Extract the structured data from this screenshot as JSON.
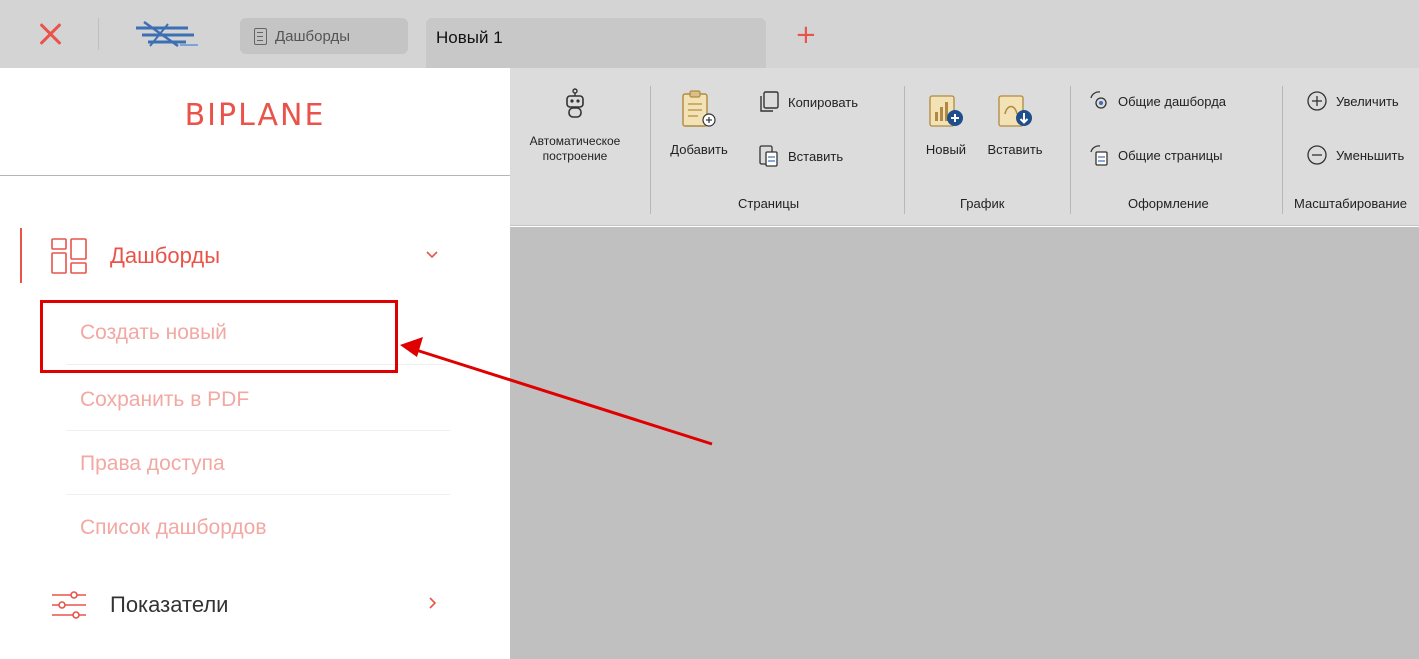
{
  "window": {
    "tabs": [
      {
        "label": "Дашборды"
      },
      {
        "label": "Новый 1"
      }
    ]
  },
  "ribbon": {
    "auto_build": {
      "label_line1": "Автоматическое",
      "label_line2": "построение"
    },
    "pages": {
      "add_label": "Добавить",
      "copy_label": "Копировать",
      "paste_label": "Вставить",
      "group_label": "Страницы"
    },
    "chart": {
      "new_label": "Новый",
      "paste_label": "Вставить",
      "group_label": "График"
    },
    "design": {
      "shared_dashboards_label": "Общие дашборда",
      "shared_pages_label": "Общие страницы",
      "group_label": "Оформление"
    },
    "zoom": {
      "increase_label": "Увеличить",
      "decrease_label": "Уменьшить",
      "group_label": "Масштабирование"
    }
  },
  "sidebar": {
    "brand": "BIPLANE",
    "dashboards": {
      "label": "Дашборды",
      "subitems": [
        {
          "label": "Создать новый"
        },
        {
          "label": "Сохранить в PDF"
        },
        {
          "label": "Права доступа"
        },
        {
          "label": "Список дашбордов"
        }
      ]
    },
    "indicators": {
      "label": "Показатели"
    }
  },
  "colors": {
    "accent": "#e9534a",
    "subitem_text": "#f2a8a3",
    "annotation": "#e00000",
    "workspace": "#c0c0c0",
    "ribbon": "#dcdcdc"
  }
}
